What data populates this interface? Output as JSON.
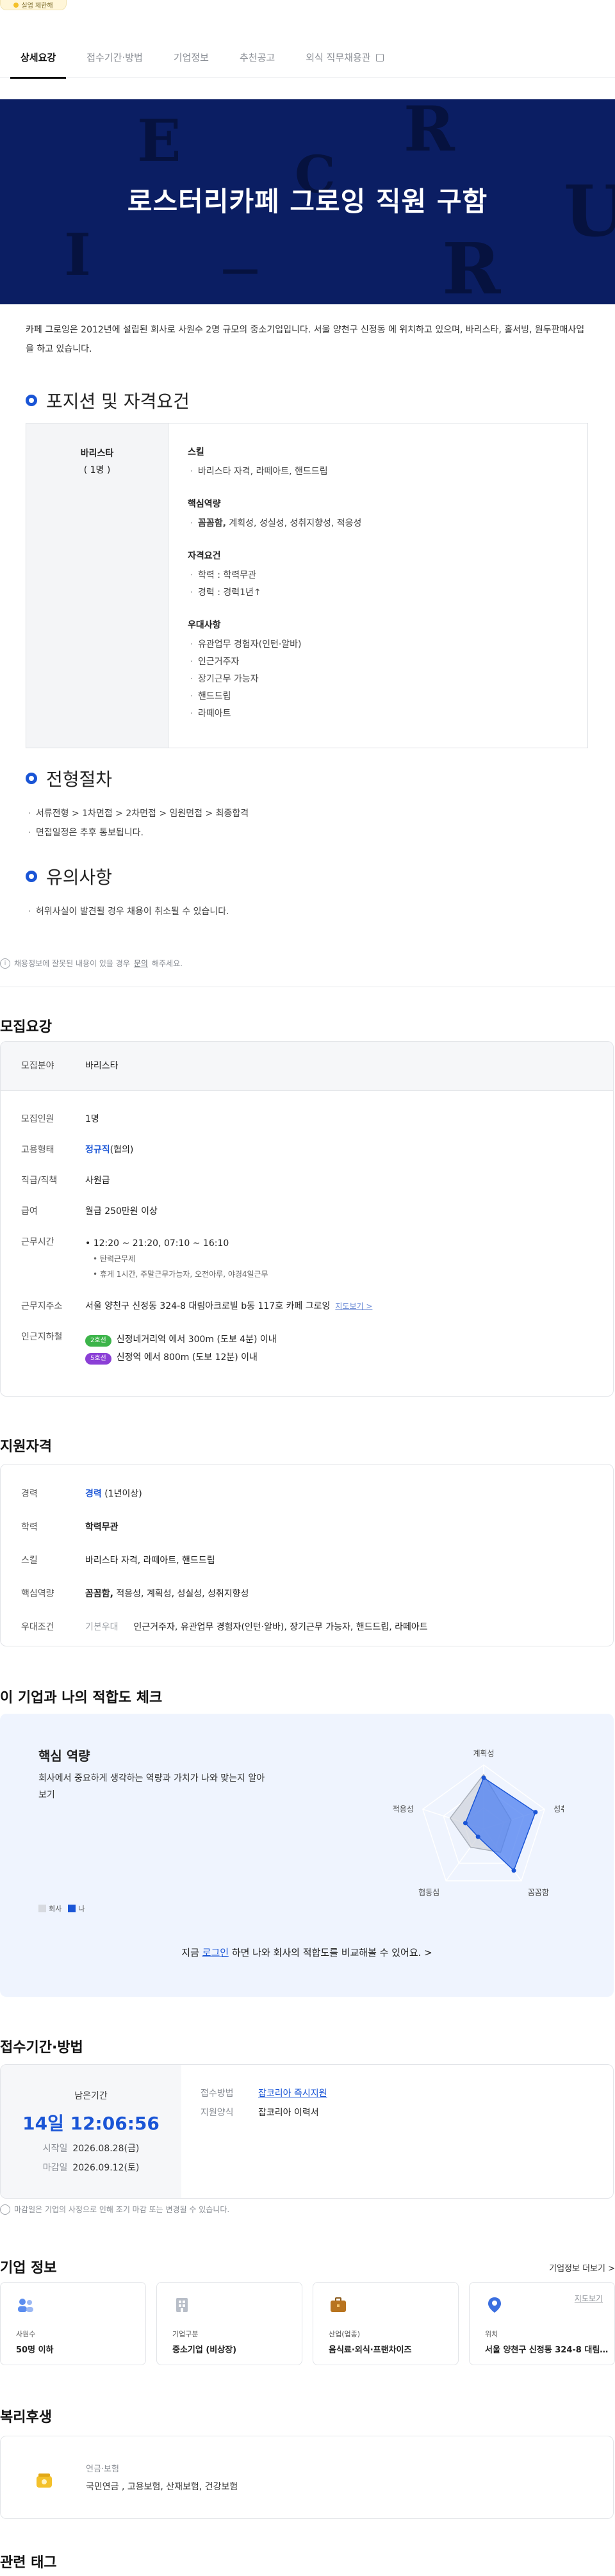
{
  "top_badge": "실업 제한해",
  "tabs": [
    {
      "label": "상세요강",
      "active": true
    },
    {
      "label": "접수기간·방법"
    },
    {
      "label": "기업정보"
    },
    {
      "label": "추천공고"
    },
    {
      "label": "외식 직무채용관"
    }
  ],
  "hero": {
    "title": "로스터리카페 그로잉 직원 구함",
    "bg_color": "#0b1e63"
  },
  "intro": "카페 그로잉은 2012년에 설립된 회사로 사원수 2명 규모의 중소기업입니다. 서울 양천구 신정동 에 위치하고 있으며, 바리스타, 홀서빙, 원두판매사업을 하고 있습니다.",
  "sections": {
    "position": "포지션 및 자격요건",
    "process": "전형절차",
    "caution": "유의사항"
  },
  "position": {
    "name": "바리스타",
    "count": "( 1명 )",
    "groups": [
      {
        "title": "스킬",
        "items": [
          "바리스타 자격, 라떼아트, 핸드드립"
        ]
      },
      {
        "title": "핵심역량",
        "items_bold": "꼼꼼함,",
        "items_rest": " 계획성, 성실성, 성취지향성, 적응성"
      },
      {
        "title": "자격요건",
        "items": [
          "학력 : 학력무관",
          "경력 : 경력1년↑"
        ]
      },
      {
        "title": "우대사항",
        "items": [
          "유관업무 경험자(인턴·알바)",
          "인근거주자",
          "장기근무 가능자",
          "핸드드립",
          "라떼아트"
        ]
      }
    ]
  },
  "process_items": [
    "서류전형 > 1차면접 > 2차면접 > 임원면접 > 최종합격",
    "면접일정은 추후 통보됩니다."
  ],
  "caution_items": [
    "허위사실이 발견될 경우 채용이 취소될 수 있습니다."
  ],
  "notice": {
    "icon": "i",
    "text": "채용정보에 잘못된 내용이 있을 경우 ",
    "link": "문의",
    "tail": "해주세요."
  },
  "recruit": {
    "title": "모집요강",
    "field_label": "모집분야",
    "field_value": "바리스타",
    "rows": [
      {
        "k": "모집인원",
        "v": "1명"
      },
      {
        "k": "고용형태",
        "v_bold": "정규직",
        "v": "(협의)"
      },
      {
        "k": "직급/직책",
        "v": "사원급"
      },
      {
        "k": "급여",
        "v": "월급 250만원 이상"
      }
    ],
    "hours_label": "근무시간",
    "hours": [
      "12:20 ~ 21:20, 07:10 ~ 16:10"
    ],
    "hours_sub": [
      "탄력근무제",
      "휴게 1시간, 주말근무가능자, 오전아루, 야경4일근무"
    ],
    "addr_label": "근무지주소",
    "addr": "서울 양천구 신정동 324-8 대림아크로빌 b동 117호 카페 그로잉",
    "map_link": "지도보기 >",
    "subway_label": "인근지하철",
    "subway": [
      {
        "line": "2호선",
        "color": "#3cb44a",
        "text": "신정네거리역 에서 300m (도보 4분) 이내"
      },
      {
        "line": "5호선",
        "color": "#8b3fd6",
        "text": "신정역 에서 800m (도보 12분) 이내"
      }
    ]
  },
  "qualify": {
    "title": "지원자격",
    "career_label": "경력",
    "career_bold": "경력",
    "career_rest": " (1년이상)",
    "edu_label": "학력",
    "edu_value": "학력무관",
    "skill_label": "스킬",
    "skill_value": "바리스타 자격, 라떼아트, 핸드드립",
    "core_label": "핵심역량",
    "core_bold": "꼼꼼함,",
    "core_rest": " 적응성, 계획성, 성실성, 성취지향성",
    "pref_label": "우대조건",
    "pref_tag": "기본우대",
    "pref_value": "인근거주자, 유관업무 경험자(인턴·알바), 장기근무 가능자, 핸드드립, 라떼아트"
  },
  "fit": {
    "title": "이 기업과 나의 적합도 체크",
    "card_title": "핵심 역량",
    "desc": "회사에서 중요하게 생각하는 역량과 가치가 나와 맞는지 알아보기",
    "legend": [
      {
        "label": "회사",
        "color": "#d7dae0"
      },
      {
        "label": "나",
        "color": "#1a55d6"
      }
    ],
    "cta_pre": "지금 ",
    "cta_link": "로그인",
    "cta_post": " 하면 나와 회사의 적합도를 비교해볼 수 있어요. >"
  },
  "chart_data": {
    "type": "radar",
    "axes": [
      "계획성",
      "성취지향성",
      "꼼꼼함",
      "협동심",
      "적응성"
    ],
    "series": [
      {
        "name": "회사",
        "values": [
          0.85,
          0.45,
          0.45,
          0.35,
          0.55
        ]
      },
      {
        "name": "나",
        "values": [
          0.8,
          0.85,
          0.8,
          0.15,
          0.3
        ]
      }
    ],
    "range": [
      0,
      1
    ]
  },
  "apply": {
    "title": "접수기간·방법",
    "remain_label": "남은기간",
    "countdown": "14일 12:06:56",
    "start_label": "시작일",
    "start": "2026.08.28(금)",
    "end_label": "마감일",
    "end": "2026.09.12(토)",
    "method_label": "접수방법",
    "method": "잡코리아 즉시지원",
    "form_label": "지원양식",
    "form": "잡코리아 이력서"
  },
  "apply_note": "마감일은 기업의 사정으로 인해 조기 마감 또는 변경될 수 있습니다.",
  "company": {
    "title": "기업 정보",
    "more": "기업정보 더보기 >",
    "cards": [
      {
        "label": "사원수",
        "value": "50명 이하",
        "icon": "people-icon"
      },
      {
        "label": "기업구분",
        "value": "중소기업 (비상장)",
        "icon": "building-icon"
      },
      {
        "label": "산업(업종)",
        "value": "음식료·외식·프랜차이즈",
        "icon": "briefcase-icon"
      },
      {
        "label": "위치",
        "value": "서울 양천구 신정동 324-8 대림…",
        "icon": "location-icon",
        "map": "지도보기"
      }
    ]
  },
  "welfare": {
    "title": "복리후생",
    "label": "연금·보험",
    "value": "국민연금 , 고용보험, 산재보험, 건강보험"
  },
  "tags_title": "관련 태그"
}
